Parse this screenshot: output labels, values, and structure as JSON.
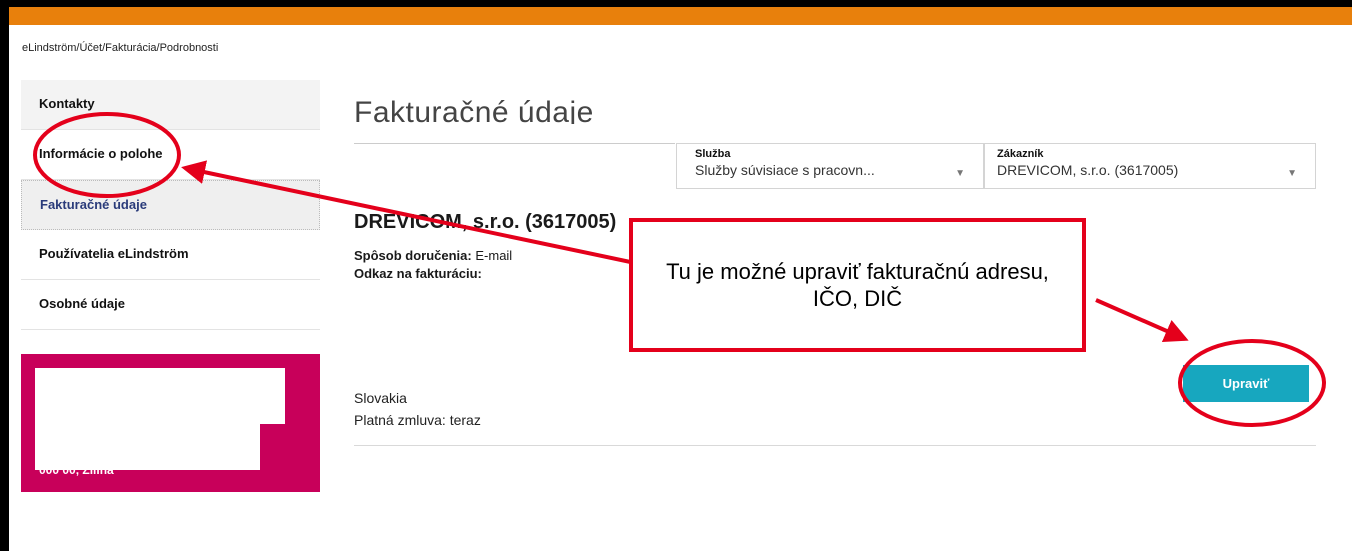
{
  "breadcrumb": [
    "eLindström",
    "Účet",
    "Fakturácia",
    "Podrobnosti"
  ],
  "sidebar": {
    "items": [
      {
        "label": "Kontakty"
      },
      {
        "label": "Informácie o polohe"
      },
      {
        "label": "Fakturačné údaje"
      },
      {
        "label": "Používatelia eLindström"
      },
      {
        "label": "Osobné údaje"
      }
    ],
    "promo_visible_text": "000 00, Žilina"
  },
  "main": {
    "title": "Fakturačné údaje",
    "service": {
      "label": "Služba",
      "value": "Služby súvisiace s pracovn..."
    },
    "customer": {
      "label": "Zákazník",
      "value": "DREVICOM, s.r.o. (3617005)"
    },
    "customer_name": "DREVICOM, s.r.o. (3617005)",
    "delivery_label": "Spôsob doručenia:",
    "delivery_value": "E-mail",
    "billing_ref_label": "Odkaz na fakturáciu:",
    "country": "Slovakia",
    "contract": "Platná zmluva:  teraz",
    "edit_button": "Upraviť"
  },
  "annotation": {
    "callout_text": "Tu je možné upraviť fakturačnú adresu, IČO, DIČ",
    "color": "#e4001b"
  },
  "colors": {
    "accent_orange": "#e8800c",
    "button_teal": "#17a7bf",
    "promo_magenta": "#c8005a"
  }
}
